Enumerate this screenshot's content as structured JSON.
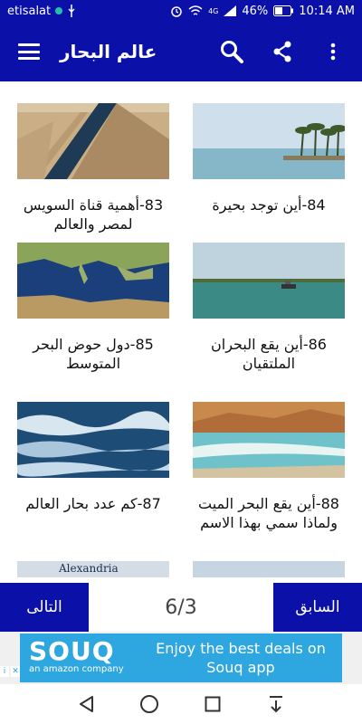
{
  "status_bar": {
    "carrier": "etisalat",
    "network": "4G",
    "battery": "46%",
    "time": "10:14 AM"
  },
  "app_bar": {
    "title": "عالم البحار",
    "icons": [
      "hamburger-menu-icon",
      "search-icon",
      "share-icon",
      "more-vert-icon"
    ]
  },
  "cards": [
    {
      "id": "card-83",
      "caption": "83-أهمية قناة السويس لمصر والعالم",
      "image": "suez-canal-aerial"
    },
    {
      "id": "card-84",
      "caption": "84-أين توجد بحيرة",
      "image": "lake-palm-trees"
    },
    {
      "id": "card-85",
      "caption": "85-دول حوض البحر المتوسط",
      "image": "mediterranean-map"
    },
    {
      "id": "card-86",
      "caption": "86-أين يقع البحران الملتقيان",
      "image": "sea-boat"
    },
    {
      "id": "card-87",
      "caption": "87-كم عدد بحار العالم",
      "image": "stormy-sea"
    },
    {
      "id": "card-88",
      "caption": "88-أين يقع البحر الميت ولماذا سمي بهذا الاسم",
      "image": "dead-sea-shore"
    },
    {
      "id": "card-89",
      "caption": "Alexandria",
      "image": "alexandria-sign"
    },
    {
      "id": "card-90",
      "caption": "",
      "image": "sky-partial"
    }
  ],
  "pagination": {
    "next_label": "التالى",
    "prev_label": "السابق",
    "page": "6/3"
  },
  "ad": {
    "brand": "SOUQ",
    "sub": "an amazon company",
    "text": "Enjoy the best deals on Souq app"
  },
  "colors": {
    "primary": "#0a10a8",
    "ad_bg": "#2ea7e0"
  }
}
